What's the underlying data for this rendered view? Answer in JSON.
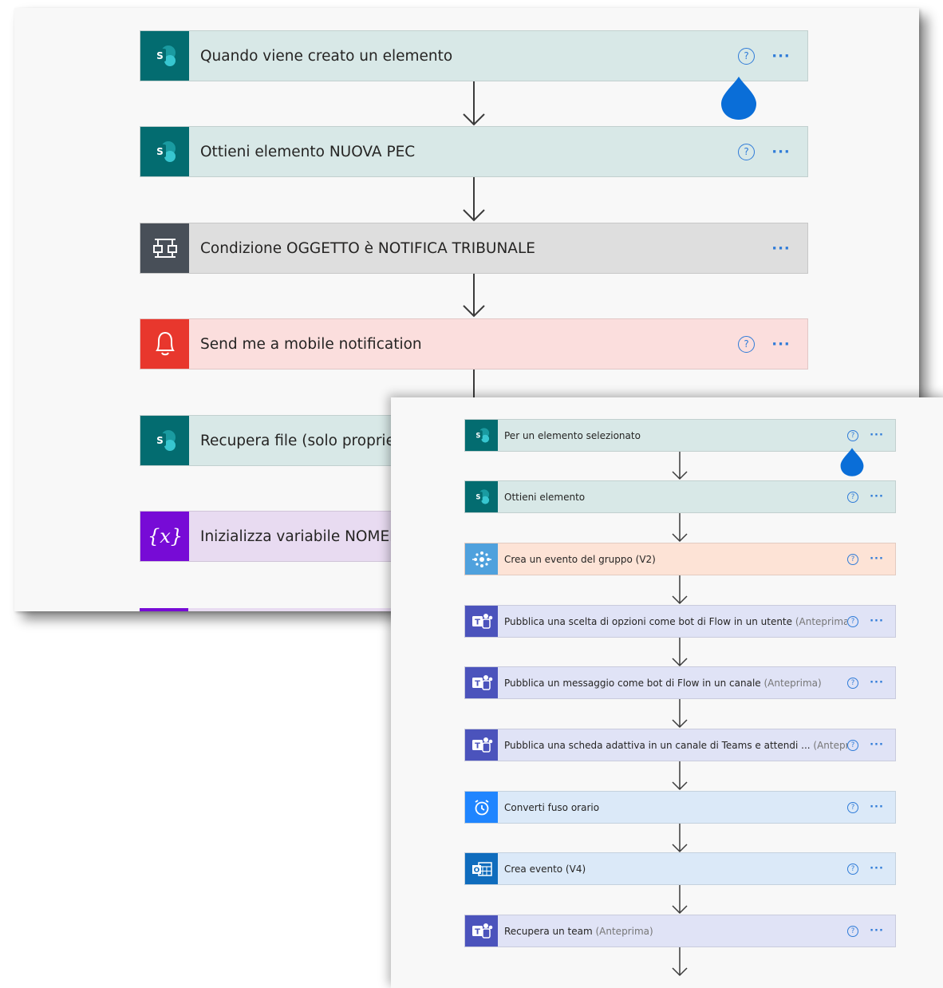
{
  "colors": {
    "accent": "#2f7bd8",
    "sharepoint": "#036c70",
    "condition": "#484f58",
    "notification": "#e8372d",
    "variable": "#770bd6",
    "office_groups": "#4fa1dd",
    "teams": "#4b53bc",
    "date_time": "#1f85ff",
    "outlook": "#0f6cbd",
    "drop_marker": "#0a6ed8"
  },
  "back_window": {
    "steps": [
      {
        "title": "Quando viene creato un elemento",
        "icon": "sharepoint-icon",
        "has_help": true
      },
      {
        "title": "Ottieni elemento NUOVA PEC",
        "icon": "sharepoint-icon",
        "has_help": true
      },
      {
        "title": "Condizione OGGETTO è NOTIFICA TRIBUNALE",
        "icon": "condition-icon",
        "has_help": false
      },
      {
        "title": "Send me a mobile notification",
        "icon": "bell-icon",
        "has_help": true
      },
      {
        "title": "Recupera file (solo proprietà",
        "icon": "sharepoint-icon",
        "has_help": false
      },
      {
        "title": "Inizializza variabile NOMEFI",
        "icon": "variable-icon",
        "has_help": false
      }
    ],
    "help_glyph": "?",
    "more_glyph": "···"
  },
  "front_window": {
    "steps": [
      {
        "title": "Per un elemento selezionato",
        "suffix": "",
        "icon": "sharepoint-icon"
      },
      {
        "title": "Ottieni elemento",
        "suffix": "",
        "icon": "sharepoint-icon"
      },
      {
        "title": "Crea un evento del gruppo (V2)",
        "suffix": "",
        "icon": "office-groups-icon"
      },
      {
        "title": "Pubblica una scelta di opzioni come bot di Flow in un utente",
        "suffix": "(Anteprima)",
        "icon": "teams-icon"
      },
      {
        "title": "Pubblica un messaggio come bot di Flow in un canale",
        "suffix": "(Anteprima)",
        "icon": "teams-icon"
      },
      {
        "title": "Pubblica una scheda adattiva in un canale di Teams e attendi ...",
        "suffix": "(Anteprima)",
        "icon": "teams-icon"
      },
      {
        "title": "Converti fuso orario",
        "suffix": "",
        "icon": "alarm-clock-icon"
      },
      {
        "title": "Crea evento (V4)",
        "suffix": "",
        "icon": "outlook-calendar-icon"
      },
      {
        "title": "Recupera un team",
        "suffix": "(Anteprima)",
        "icon": "teams-icon"
      }
    ],
    "help_glyph": "?",
    "more_glyph": "···"
  }
}
